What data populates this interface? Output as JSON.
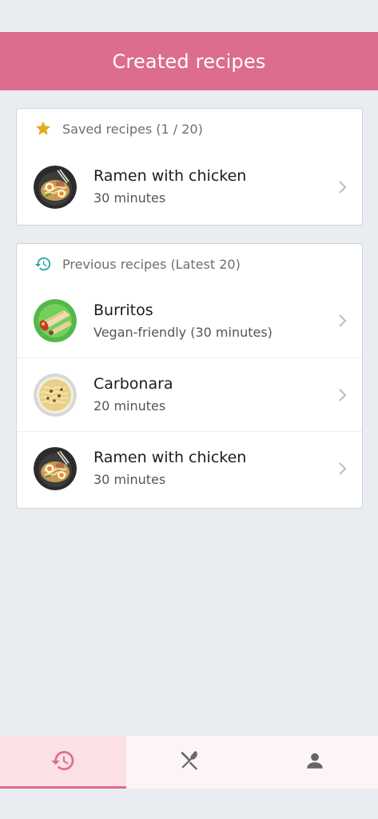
{
  "header": {
    "title": "Created recipes"
  },
  "saved": {
    "heading": "Saved recipes (1 / 20)",
    "items": [
      {
        "title": "Ramen with chicken",
        "subtitle": "30 minutes",
        "image": "ramen-thumbnail"
      }
    ]
  },
  "previous": {
    "heading": "Previous recipes (Latest 20)",
    "items": [
      {
        "title": "Burritos",
        "subtitle": "Vegan-friendly (30 minutes)",
        "image": "burritos-thumbnail"
      },
      {
        "title": "Carbonara",
        "subtitle": "20 minutes",
        "image": "carbonara-thumbnail"
      },
      {
        "title": "Ramen with chicken",
        "subtitle": "30 minutes",
        "image": "ramen-thumbnail"
      }
    ]
  },
  "tabs": [
    {
      "icon": "history-icon",
      "active": true
    },
    {
      "icon": "utensils-icon",
      "active": false
    },
    {
      "icon": "person-icon",
      "active": false
    }
  ],
  "colors": {
    "brand": "#dc6d8d",
    "star": "#e2aa1c",
    "history_teal": "#2aa6a0",
    "background": "#e9edf1"
  }
}
